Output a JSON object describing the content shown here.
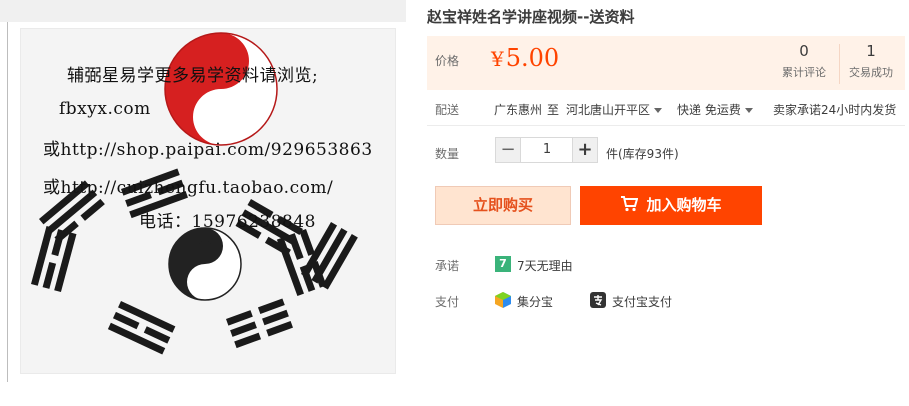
{
  "product": {
    "title": "赵宝祥姓名学讲座视频--送资料",
    "image_text": {
      "line1": "辅弼星易学更多易学资料请浏览;",
      "line2": "fbxyx.com",
      "line3": "或http://shop.paipai.com/929653863",
      "line4": "或http://cuizhengfu.taobao.com/",
      "line5": "电话：15976238848"
    }
  },
  "price": {
    "label": "价格",
    "currency": "¥",
    "amount": "5.00",
    "reviews_count": "0",
    "reviews_label": "累计评论",
    "sales_count": "1",
    "sales_label": "交易成功"
  },
  "shipping": {
    "label": "配送",
    "from": "广东惠州",
    "to_word": "至",
    "destination": "河北唐山开平区",
    "method": "快递 免运费",
    "promise": "卖家承诺24小时内发货"
  },
  "quantity": {
    "label": "数量",
    "minus": "−",
    "value": "1",
    "plus": "+",
    "stock_text": "件(库存93件)"
  },
  "actions": {
    "buy_now": "立即购买",
    "add_to_cart": "加入购物车"
  },
  "guarantee": {
    "label": "承诺",
    "badge": "7",
    "text": "7天无理由"
  },
  "payment": {
    "label": "支付",
    "method1": "集分宝",
    "method2": "支付宝支付"
  },
  "colors": {
    "accent": "#ff4400",
    "price": "#ff4400",
    "price_bg": "#fff2e8"
  }
}
